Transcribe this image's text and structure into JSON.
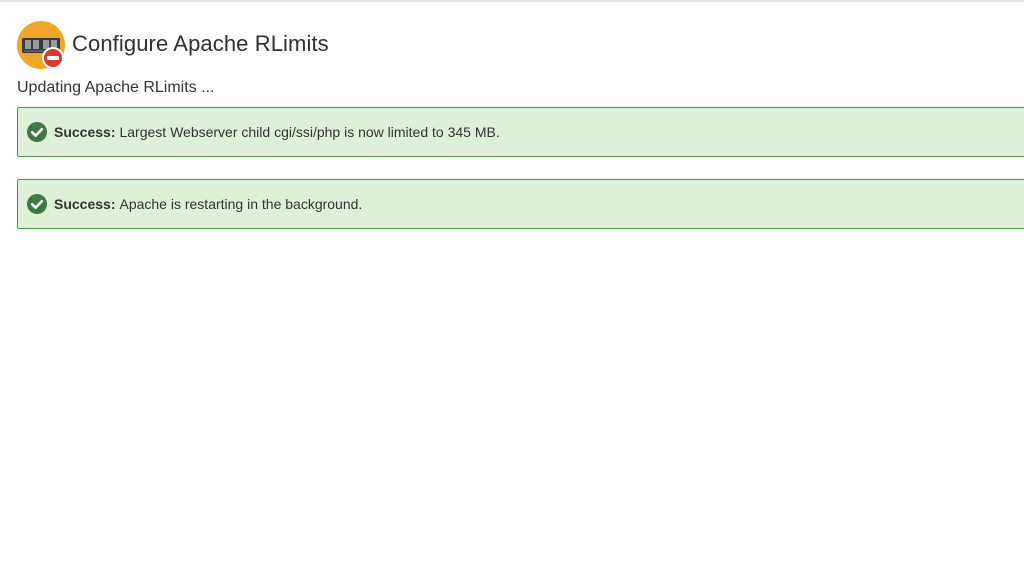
{
  "header": {
    "icon": "server-memory-blocked-icon",
    "title": "Configure Apache RLimits"
  },
  "status": {
    "text": "Updating Apache RLimits ..."
  },
  "alerts": [
    {
      "icon": "check-circle-icon",
      "label": "Success:",
      "message": "Largest Webserver child cgi/ssi/php is now limited to 345 MB."
    },
    {
      "icon": "check-circle-icon",
      "label": "Success:",
      "message": "Apache is restarting in the background."
    }
  ],
  "colors": {
    "success_background": "#dff0d8",
    "success_border": "#3c9a4a",
    "success_icon": "#3d7a3f",
    "app_icon_circle": "#f0a628",
    "blocked_badge": "#d43b2f"
  }
}
